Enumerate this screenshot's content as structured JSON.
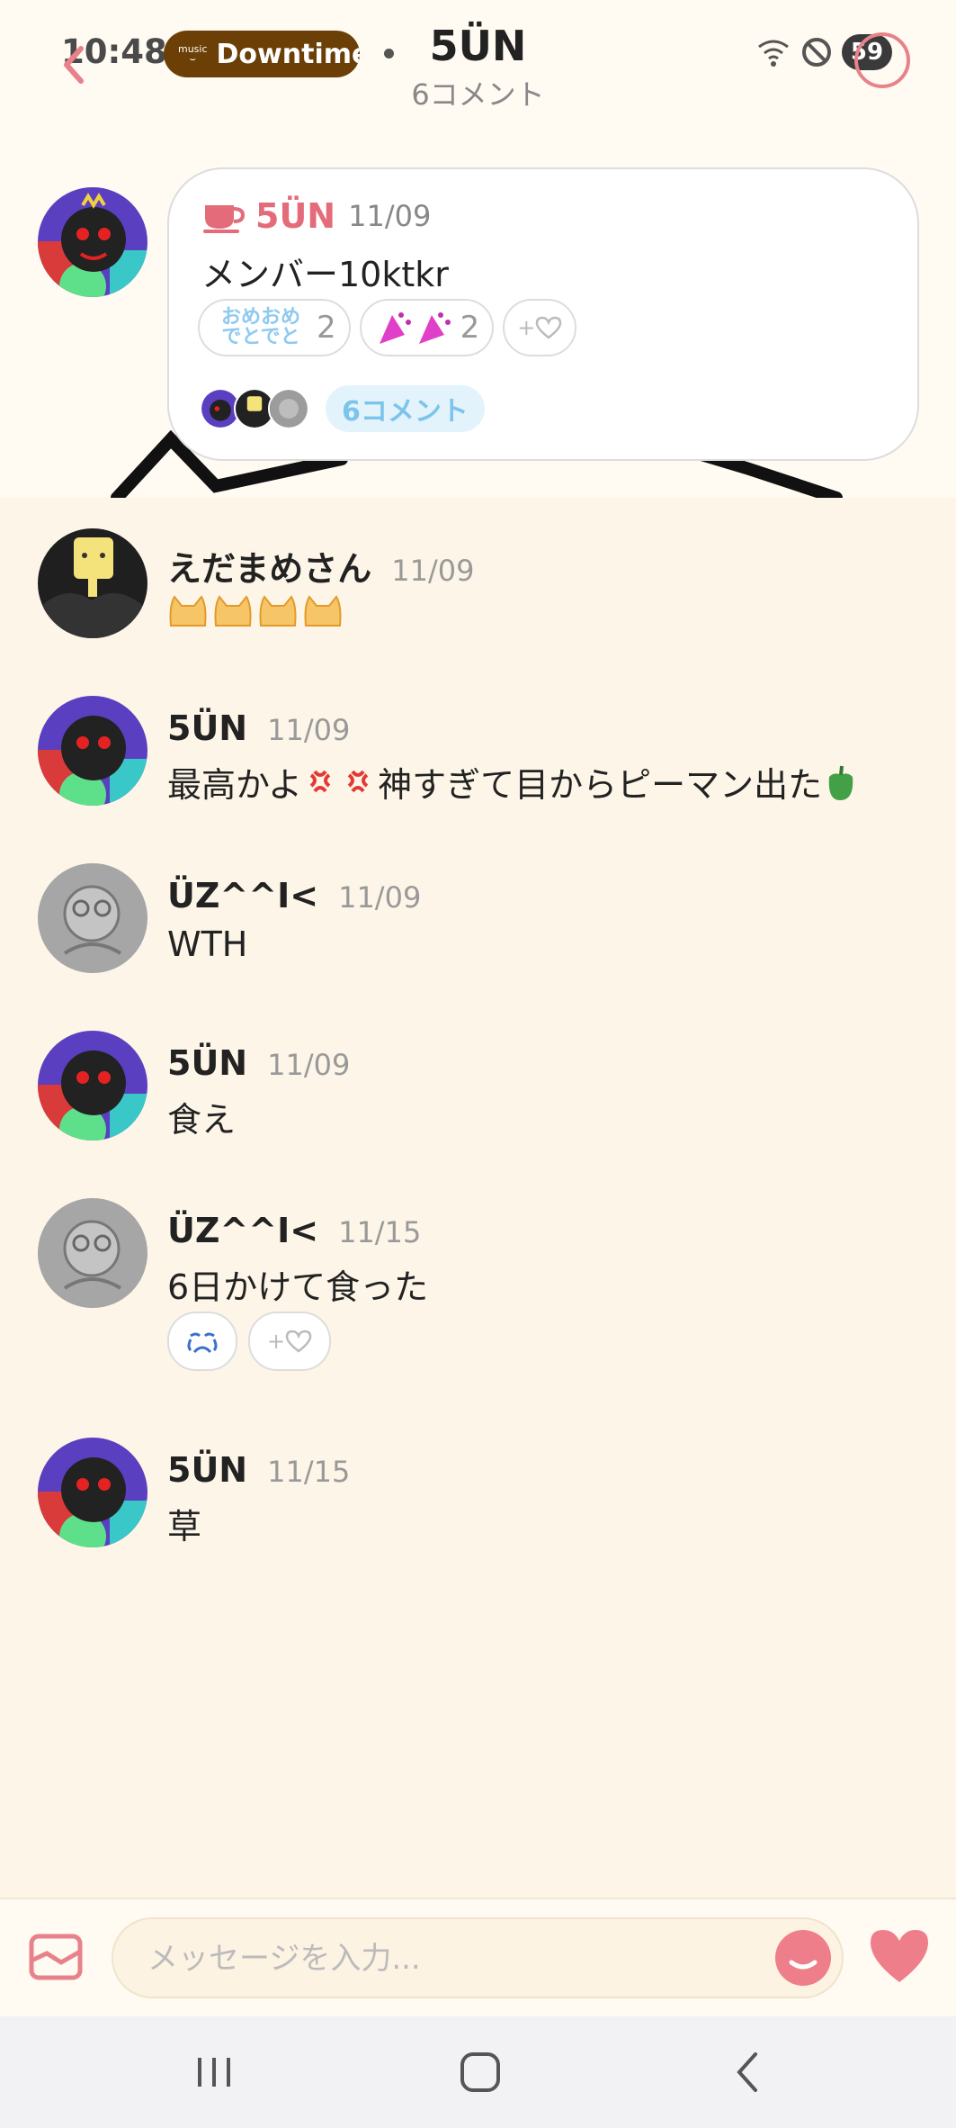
{
  "status_bar": {
    "time": "10:48",
    "battery": "59"
  },
  "media_pill": {
    "service": "music",
    "text": "Downtime"
  },
  "header": {
    "title": "5ÜN",
    "subtitle": "6コメント"
  },
  "post": {
    "author": "5ÜN",
    "date": "11/09",
    "text": "メンバー10ktkr",
    "reactions": [
      {
        "stamp": "おめおめでとでと",
        "count": "2"
      },
      {
        "stamp": "party-popper-pair",
        "count": "2"
      }
    ],
    "add_reaction": "+",
    "comment_button": "6コメント"
  },
  "comments": [
    {
      "author": "えだまめさん",
      "date": "11/09",
      "text": "",
      "emoji": [
        "cat-face",
        "cat-face",
        "cat-face",
        "cat-face"
      ]
    },
    {
      "author": "5ÜN",
      "date": "11/09",
      "text_parts": [
        "最高かよ",
        "神すぎて目からピーマン出た"
      ]
    },
    {
      "author": "ÜZ^^I<",
      "date": "11/09",
      "text": "WTH"
    },
    {
      "author": "5ÜN",
      "date": "11/09",
      "text": "食え"
    },
    {
      "author": "ÜZ^^I<",
      "date": "11/15",
      "text": "6日かけて食った",
      "reactions": [
        "crying-face"
      ],
      "add_reaction": "+"
    },
    {
      "author": "5ÜN",
      "date": "11/15",
      "text": "草"
    }
  ],
  "input": {
    "placeholder": "メッセージを入力..."
  },
  "colors": {
    "accent": "#e8828a",
    "background": "#fdf6e8",
    "author_pink": "#e46b7a",
    "comment_blue": "#7cc4ec"
  }
}
